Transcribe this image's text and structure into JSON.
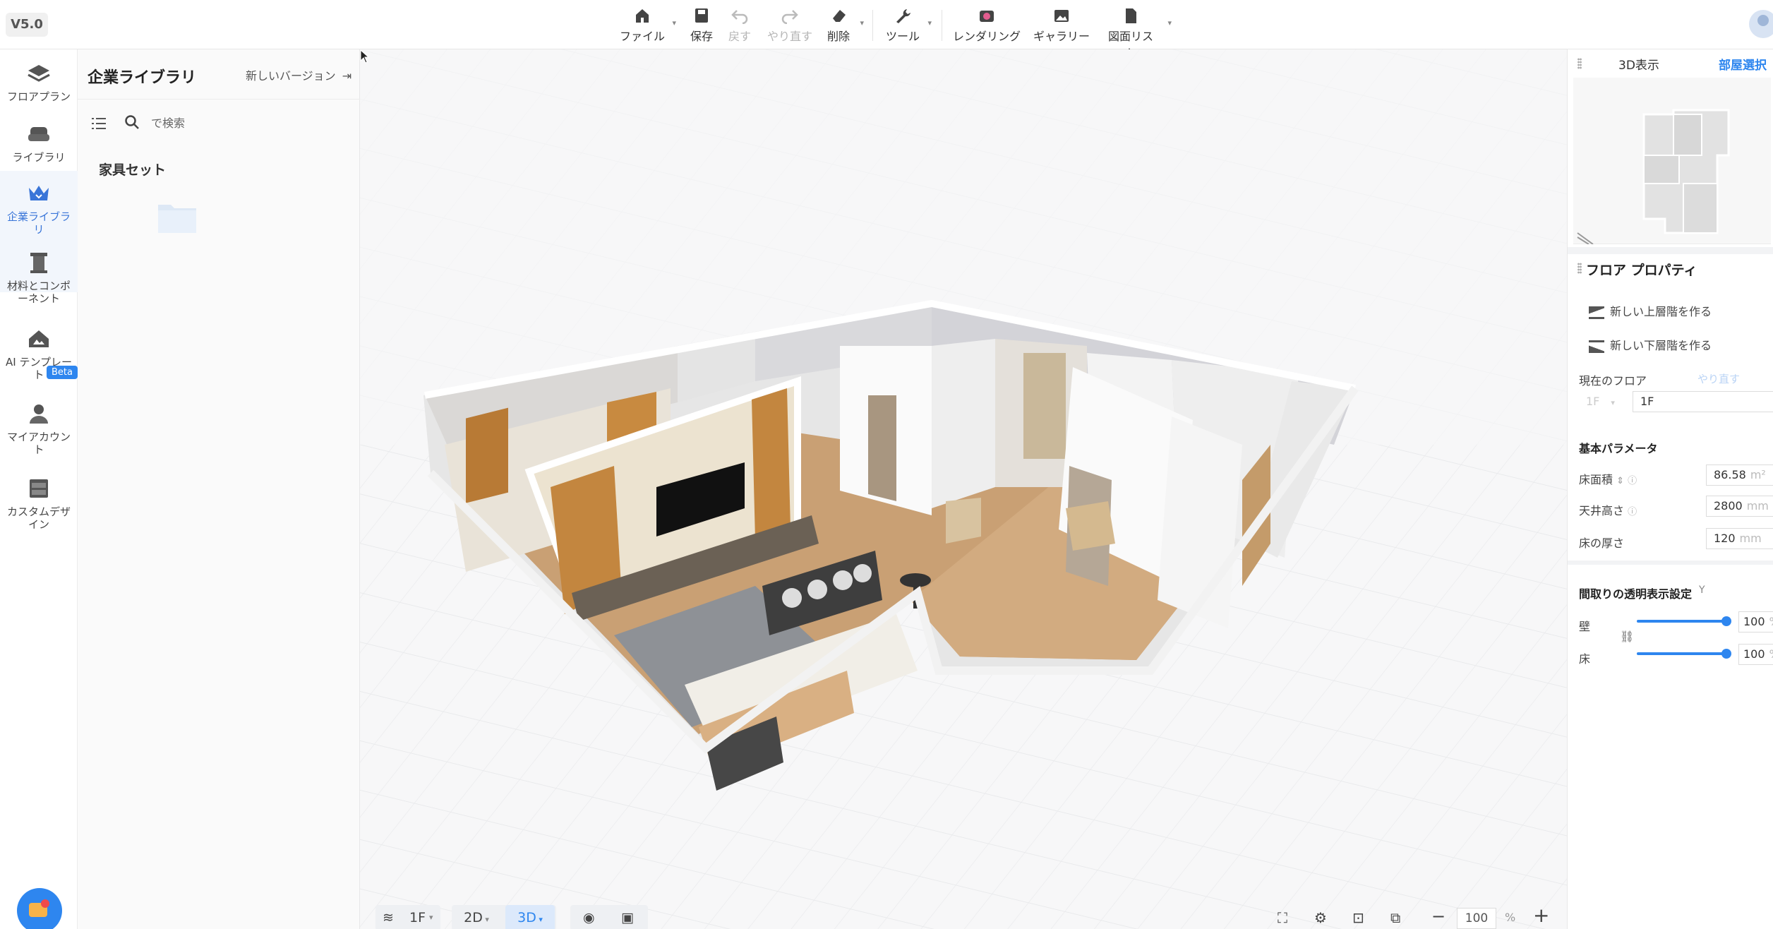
{
  "app": {
    "version": "V5.0"
  },
  "toolbar": {
    "file": "ファイル",
    "save": "保存",
    "undo": "戻す",
    "redo": "やり直す",
    "delete": "削除",
    "tools": "ツール",
    "rendering": "レンダリング",
    "gallery": "ギャラリー",
    "drawing_list": "図面リスト"
  },
  "leftnav": [
    {
      "label": "フロアプラン",
      "icon": "floor-plan-icon"
    },
    {
      "label": "ライブラリ",
      "icon": "library-icon"
    },
    {
      "label": "企業ライブラリ",
      "icon": "enterprise-library-icon",
      "active": true
    },
    {
      "label": "材料とコンポーネント",
      "icon": "materials-icon"
    },
    {
      "label": "AI テンプレート",
      "icon": "ai-template-icon",
      "badge": "Beta"
    },
    {
      "label": "マイアカウント",
      "icon": "account-icon"
    },
    {
      "label": "カスタムデザイン",
      "icon": "custom-design-icon"
    }
  ],
  "nav_labels": {
    "floor_plan": "フロアプラン",
    "library": "ライブラリ",
    "enterprise_library_1": "企業ライブラ",
    "enterprise_library_2": "リ",
    "materials_1": "材料とコンポ",
    "materials_2": "ーネント",
    "ai_template_1": "AI テンプレー",
    "ai_template_2": "ト",
    "my_account_1": "マイアカウン",
    "my_account_2": "ト",
    "custom_1": "カスタムデザ",
    "custom_2": "イン",
    "beta": "Beta"
  },
  "library": {
    "title": "企業ライブラリ",
    "new_version": "新しいバージョン",
    "search_placeholder": "で検索",
    "section": "家具セット"
  },
  "bottom_bar": {
    "floor": "1F",
    "view_2d": "2D",
    "view_3d": "3D",
    "zoom": "100",
    "zoom_unit": "%"
  },
  "right_panel": {
    "tab_3d": "3D表示",
    "tab_room_select": "部屋選択",
    "floor_properties": "フロア プロパティ",
    "new_upper_floor": "新しい上層階を作る",
    "new_lower_floor": "新しい下層階を作る",
    "current_floor_label": "現在のフロア",
    "current_floor_redo": "やり直す",
    "current_floor_select": "1F",
    "current_floor_name": "1F",
    "basic_params": "基本パラメータ",
    "floor_area_label": "床面積",
    "floor_area_value": "86.58",
    "floor_area_unit": "m²",
    "ceiling_height_label": "天井高さ",
    "ceiling_height_value": "2800",
    "ceiling_height_unit": "mm",
    "floor_thickness_label": "床の厚さ",
    "floor_thickness_value": "120",
    "floor_thickness_unit": "mm",
    "transparency_title": "間取りの透明表示設定",
    "wall_label": "壁",
    "wall_value": "100",
    "floor_label": "床",
    "floor_value": "100",
    "percent": "%"
  },
  "colors": {
    "accent": "#2e86ef",
    "wood": "#c9a074",
    "wall": "#eeeeee"
  }
}
